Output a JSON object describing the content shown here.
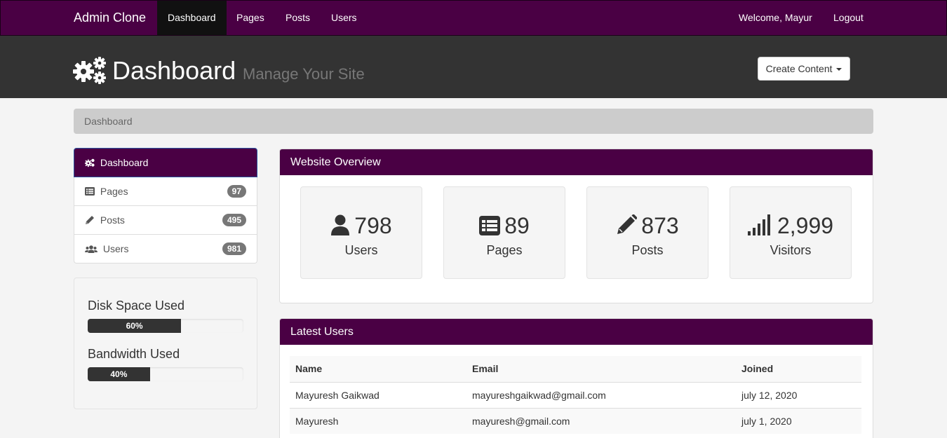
{
  "navbar": {
    "brand": "Admin Clone",
    "links": [
      "Dashboard",
      "Pages",
      "Posts",
      "Users"
    ],
    "welcome": "Welcome, Mayur",
    "logout": "Logout"
  },
  "header": {
    "title": "Dashboard",
    "subtitle": "Manage Your Site",
    "create_button": "Create Content"
  },
  "breadcrumb": "Dashboard",
  "sidebar": {
    "items": [
      {
        "label": "Dashboard",
        "icon": "gears-icon",
        "badge": ""
      },
      {
        "label": "Pages",
        "icon": "list-icon",
        "badge": "97"
      },
      {
        "label": "Posts",
        "icon": "pencil-icon",
        "badge": "495"
      },
      {
        "label": "Users",
        "icon": "users-icon",
        "badge": "981"
      }
    ]
  },
  "usage": {
    "disk_label": "Disk Space Used",
    "disk_value": "60%",
    "disk_fraction": 0.6,
    "bandwidth_label": "Bandwidth Used",
    "bandwidth_value": "40%",
    "bandwidth_fraction": 0.4
  },
  "overview": {
    "title": "Website Overview",
    "stats": [
      {
        "value": "798",
        "label": "Users",
        "icon": "user-icon"
      },
      {
        "value": "89",
        "label": "Pages",
        "icon": "list-icon"
      },
      {
        "value": "873",
        "label": "Posts",
        "icon": "pencil-icon"
      },
      {
        "value": "2,999",
        "label": "Visitors",
        "icon": "signal-icon"
      }
    ]
  },
  "latest_users": {
    "title": "Latest Users",
    "columns": [
      "Name",
      "Email",
      "Joined"
    ],
    "rows": [
      [
        "Mayuresh Gaikwad",
        "mayureshgaikwad@gmail.com",
        "july 12, 2020"
      ],
      [
        "Mayuresh",
        "mayuresh@gmail.com",
        "july 1, 2020"
      ]
    ]
  },
  "colors": {
    "brand_purple": "#4a0044",
    "header_dark": "#333333",
    "badge_gray": "#777777"
  }
}
